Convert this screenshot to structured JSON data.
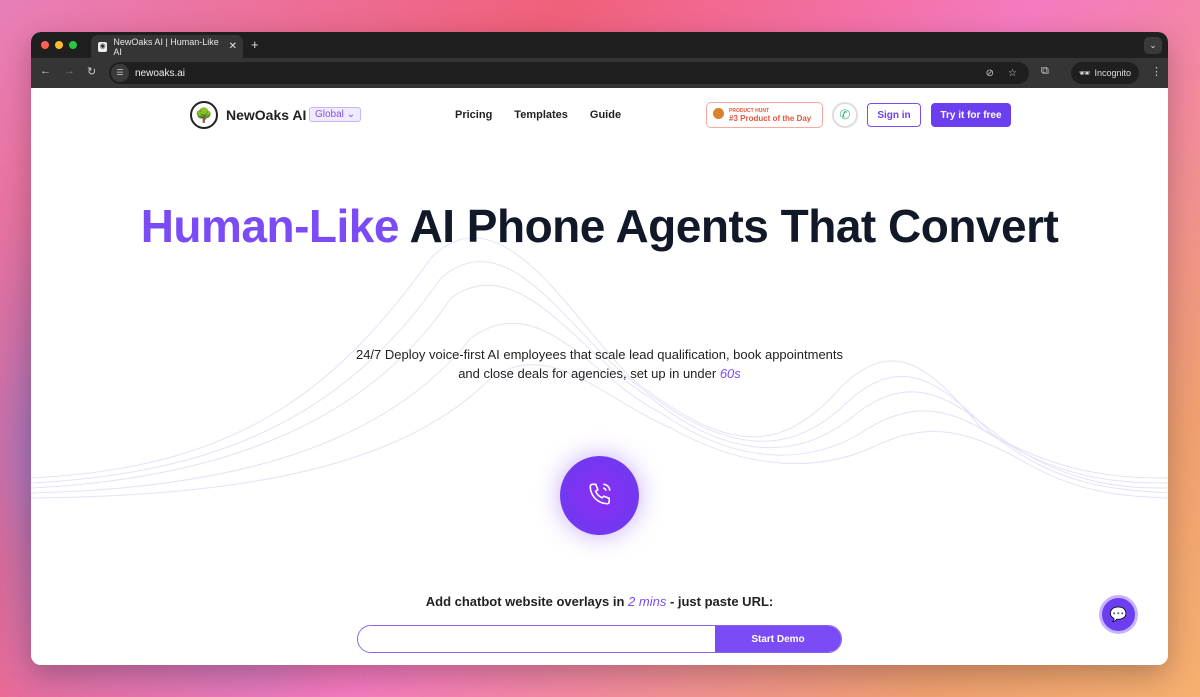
{
  "browser": {
    "tab_title": "NewOaks AI | Human-Like AI",
    "url": "newoaks.ai",
    "incognito_label": "Incognito"
  },
  "nav": {
    "brand": "NewOaks AI",
    "region": "Global",
    "links": [
      "Pricing",
      "Templates",
      "Guide"
    ],
    "badge_small": "PRODUCT HUNT",
    "badge_main": "#3 Product of the Day",
    "signin": "Sign in",
    "try": "Try it for free"
  },
  "hero": {
    "title_highlight": "Human-Like",
    "title_rest": " AI Phone Agents That Convert",
    "sub_line1": "24/7 Deploy voice-first AI employees that scale lead qualification, book appointments",
    "sub_line2": "and close deals for agencies, set up in under ",
    "sub_highlight": "60s"
  },
  "demo": {
    "cta_before": "Add chatbot website overlays in ",
    "cta_highlight": "2 mins",
    "cta_after": " - just paste URL:",
    "input_value": "",
    "button": "Start Demo"
  },
  "colors": {
    "accent": "#7b4cf6",
    "button": "#6b3ff0"
  }
}
